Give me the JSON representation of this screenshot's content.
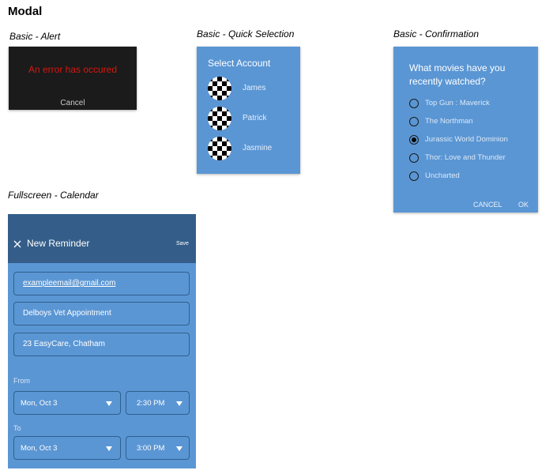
{
  "page": {
    "title": "Modal"
  },
  "alert": {
    "caption": "Basic - Alert",
    "message": "An error has occured",
    "cancel_label": "Cancel",
    "message_color": "#d8160f"
  },
  "quick_selection": {
    "caption": "Basic - Quick Selection",
    "title": "Select Account",
    "accounts": [
      {
        "name": "James",
        "avatar_icon": "checkerboard-avatar-icon"
      },
      {
        "name": "Patrick",
        "avatar_icon": "checkerboard-avatar-icon"
      },
      {
        "name": "Jasmine",
        "avatar_icon": "checkerboard-avatar-icon"
      }
    ]
  },
  "confirmation": {
    "caption": "Basic - Confirmation",
    "title": "What movies have you recently watched?",
    "options": [
      {
        "label": "Top Gun : Maverick",
        "selected": false
      },
      {
        "label": "The Northman",
        "selected": false
      },
      {
        "label": "Jurassic World Dominion",
        "selected": true
      },
      {
        "label": "Thor: Love and Thunder",
        "selected": false
      },
      {
        "label": "Uncharted",
        "selected": false
      }
    ],
    "cancel_label": "CANCEL",
    "ok_label": "OK"
  },
  "calendar": {
    "caption": "Fullscreen - Calendar",
    "title": "New Reminder",
    "save_label": "Save",
    "close_icon": "close-icon",
    "email": "exampleemail@gmail.com",
    "event": "Delboys Vet Appointment",
    "location": "23 EasyCare, Chatham",
    "from_label": "From",
    "from_date": "Mon, Oct 3",
    "from_time": "2:30 PM",
    "to_label": "To",
    "to_date": "Mon, Oct 3",
    "to_time": "3:00 PM"
  },
  "colors": {
    "modal_blue": "#5a96d4",
    "header_blue": "#345e89",
    "alert_bg": "#1b1b1b"
  }
}
